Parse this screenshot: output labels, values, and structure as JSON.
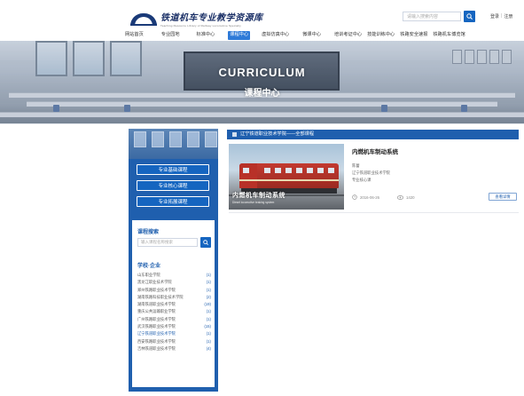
{
  "header": {
    "logo_title": "铁道机车专业教学资源库",
    "logo_subtitle": "Teaching Resource Library of Railway Locomotive Specialty",
    "search_placeholder": "请输入搜索内容",
    "login_label": "登录",
    "separator": "|",
    "register_label": "注册"
  },
  "nav": {
    "items": [
      {
        "label": "网站首页",
        "active": false
      },
      {
        "label": "专业园地",
        "active": false
      },
      {
        "label": "标准中心",
        "active": false
      },
      {
        "label": "课程中心",
        "active": true
      },
      {
        "label": "虚拟仿真中心",
        "active": false
      },
      {
        "label": "微课中心",
        "active": false
      },
      {
        "label": "培训考证中心",
        "active": false
      },
      {
        "label": "技能训练中心",
        "active": false
      },
      {
        "label": "铁路安全速报",
        "active": false
      },
      {
        "label": "铁路机车博览馆",
        "active": false
      }
    ]
  },
  "banner": {
    "english_title": "CURRICULUM",
    "chinese_title": "课程中心"
  },
  "sidebar": {
    "category_buttons": [
      "专业基础课程",
      "专业核心课程",
      "专业拓展课程"
    ],
    "search_title": "课程搜索",
    "search_placeholder": "输入课程名称搜索",
    "school_title": "学校·企业",
    "schools": [
      {
        "name": "山东职业学院",
        "count": "(1)",
        "active": false
      },
      {
        "name": "黑龙江职业技术学院",
        "count": "(1)",
        "active": false
      },
      {
        "name": "郑州铁路职业技术学院",
        "count": "(1)",
        "active": false
      },
      {
        "name": "湖南铁路科技职业技术学院",
        "count": "(2)",
        "active": false
      },
      {
        "name": "湖南铁道职业技术学院",
        "count": "(19)",
        "active": false
      },
      {
        "name": "重庆公共运输职业学院",
        "count": "(1)",
        "active": false
      },
      {
        "name": "广州铁路职业技术学院",
        "count": "(1)",
        "active": false
      },
      {
        "name": "武汉铁路职业技术学院",
        "count": "(15)",
        "active": false
      },
      {
        "name": "辽宁铁道职业技术学院",
        "count": "(1)",
        "active": true
      },
      {
        "name": "西安铁路职业技术学院",
        "count": "(1)",
        "active": false
      },
      {
        "name": "吉林铁道职业技术学院",
        "count": "(4)",
        "active": false
      }
    ]
  },
  "content": {
    "crumb": "辽宁铁道职业技术学院——全部课程",
    "course": {
      "image_title": "内燃机车制动系统",
      "image_subtitle": "Diesel locomotive braking system",
      "title": "内燃机车制动系统",
      "teacher_label": "陈蕾",
      "school": "辽宁铁道职业技术学院",
      "category": "专业核心课",
      "date": "2016-06-26",
      "views": "1420",
      "button_label": "查看详情"
    }
  },
  "colors": {
    "primary": "#1f5fae",
    "accent": "#1565c0",
    "nav_active": "#2e7ad8"
  }
}
